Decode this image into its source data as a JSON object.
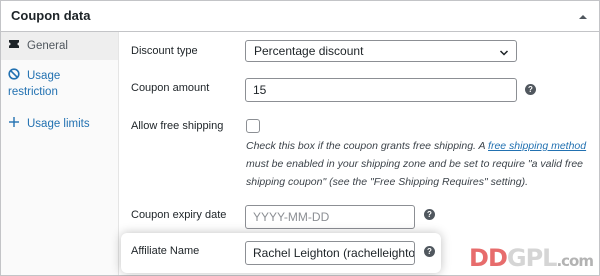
{
  "panel": {
    "title": "Coupon data"
  },
  "tabs": [
    {
      "label": "General",
      "icon": "ticket-icon",
      "active": true
    },
    {
      "label": "Usage restriction",
      "icon": "block-icon",
      "active": false
    },
    {
      "label": "Usage limits",
      "icon": "plus-icon",
      "active": false
    }
  ],
  "fields": {
    "discount_type": {
      "label": "Discount type",
      "value": "Percentage discount"
    },
    "coupon_amount": {
      "label": "Coupon amount",
      "value": "15"
    },
    "free_shipping": {
      "label": "Allow free shipping",
      "checked": false,
      "desc_before": "Check this box if the coupon grants free shipping. A ",
      "desc_link": "free shipping method",
      "desc_after": " must be enabled in your shipping zone and be set to require \"a valid free shipping coupon\" (see the \"Free Shipping Requires\" setting)."
    },
    "expiry_date": {
      "label": "Coupon expiry date",
      "placeholder": "YYYY-MM-DD"
    },
    "affiliate_name": {
      "label": "Affiliate Name",
      "value": "Rachel Leighton (rachelleighton"
    }
  },
  "help_glyph": "?",
  "watermark": {
    "part1": "DD",
    "part2": "GPL",
    "part3": ".com"
  },
  "colors": {
    "link": "#2271b1",
    "border": "#c3c4c7",
    "watermark_red": "#e03c3c"
  }
}
